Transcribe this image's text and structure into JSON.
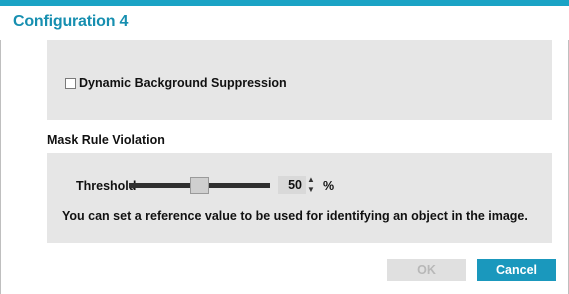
{
  "dialog": {
    "title": "Configuration 4"
  },
  "dynamic_background_suppression": {
    "label": "Dynamic Background Suppression",
    "checked": false
  },
  "mask_rule_violation": {
    "section_label": "Mask Rule Violation",
    "threshold_label": "Threshold",
    "threshold_value": "50",
    "threshold_percent": 0.5,
    "unit": "%",
    "hint": "You can set a reference value to be used for identifying an object in the image."
  },
  "buttons": {
    "ok_label": "OK",
    "cancel_label": "Cancel"
  },
  "colors": {
    "accent": "#1aa3c5",
    "title_text": "#178fb0",
    "panel_bg": "#e6e6e6",
    "cancel_bg": "#1a98bd",
    "ok_disabled_bg": "#e0e0e0"
  },
  "icons": {
    "spin_up": "▲",
    "spin_down": "▼"
  }
}
